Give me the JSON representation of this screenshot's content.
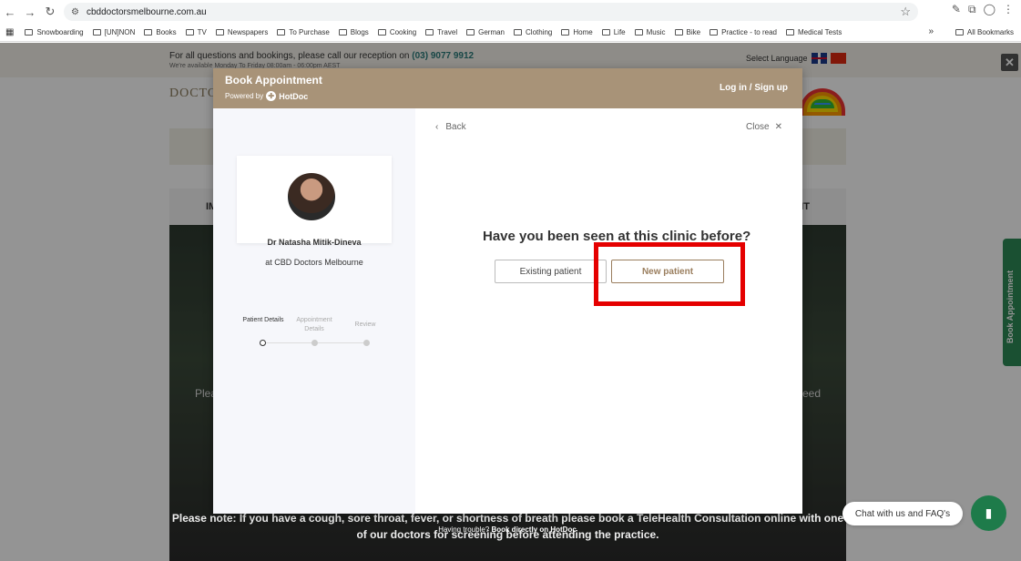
{
  "browser": {
    "url": "cbddoctorsmelbourne.com.au",
    "bookmarks": [
      "Snowboarding",
      "[UN]NON",
      "Books",
      "TV",
      "Newspapers",
      "To Purchase",
      "Blogs",
      "Cooking",
      "Travel",
      "German",
      "Clothing",
      "Home",
      "Life",
      "Music",
      "Bike",
      "Practice - to read",
      "Medical Tests"
    ],
    "all_bookmarks": "All Bookmarks"
  },
  "page": {
    "reception_text": "For all questions and bookings, please call our reception on ",
    "phone": "(03) 9077 9912",
    "hours": "We're available Monday To Friday 08:00am - 06:00pm AEST",
    "select_language": "Select Language",
    "logo_text": "DOCTO",
    "menu_left": "IM",
    "menu_right": "IT",
    "hero_plea": "Plea",
    "hero_eed": "eed",
    "bottom_note": "Please note: If you have a cough, sore throat, fever, or shortness of breath please book a TeleHealth Consultation online with one of our doctors for screening before attending the practice.",
    "book_tab": "Book Appointment"
  },
  "modal": {
    "title": "Book Appointment",
    "powered_by": "Powered by",
    "hotdoc": "HotDoc",
    "login": "Log in / Sign up",
    "back": "Back",
    "close": "Close",
    "doctor_name": "Dr Natasha Mitik-Dineva",
    "clinic": "at CBD Doctors Melbourne",
    "steps": [
      "Patient Details",
      "Appointment Details",
      "Review"
    ],
    "question": "Have you been seen at this clinic before?",
    "existing_patient": "Existing patient",
    "new_patient": "New patient",
    "trouble_text": "Having trouble? ",
    "book_directly": "Book directly on HotDoc"
  },
  "chat": {
    "label": "Chat with us and FAQ's"
  },
  "colors": {
    "modal_header": "#a89378",
    "highlight": "#e50000",
    "chat": "#1e7b4a"
  }
}
